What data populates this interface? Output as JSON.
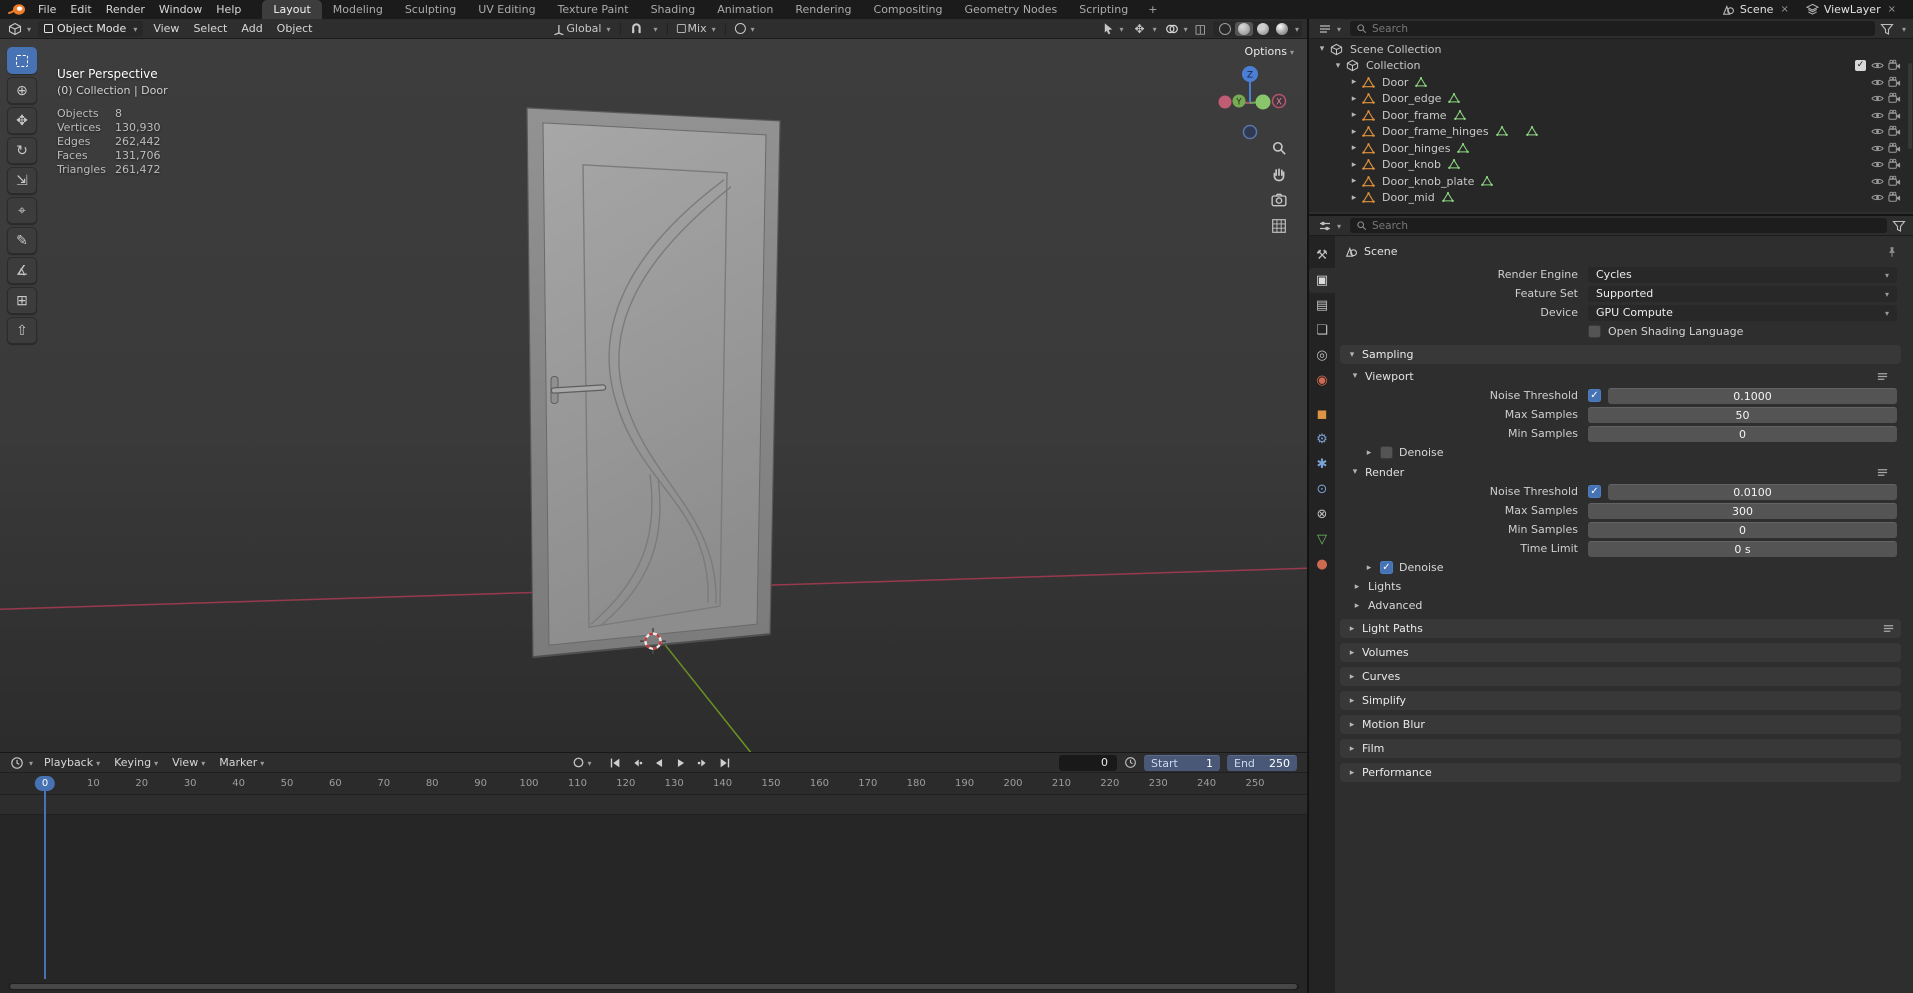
{
  "topbar": {
    "menus": [
      {
        "label": "File"
      },
      {
        "label": "Edit"
      },
      {
        "label": "Render"
      },
      {
        "label": "Window"
      },
      {
        "label": "Help"
      }
    ],
    "workspaces": [
      {
        "label": "Layout",
        "active": true
      },
      {
        "label": "Modeling"
      },
      {
        "label": "Sculpting"
      },
      {
        "label": "UV Editing"
      },
      {
        "label": "Texture Paint"
      },
      {
        "label": "Shading"
      },
      {
        "label": "Animation"
      },
      {
        "label": "Rendering"
      },
      {
        "label": "Compositing"
      },
      {
        "label": "Geometry Nodes"
      },
      {
        "label": "Scripting"
      }
    ],
    "add_workspace_label": "+",
    "scene_label": "Scene",
    "viewlayer_label": "ViewLayer"
  },
  "viewport_header": {
    "mode": "Object Mode",
    "menus": [
      {
        "label": "View"
      },
      {
        "label": "Select"
      },
      {
        "label": "Add"
      },
      {
        "label": "Object"
      }
    ],
    "orientation": "Global",
    "snap_target": "Mix",
    "options_label": "Options"
  },
  "tools": [
    {
      "name": "select-box",
      "glyph": "",
      "active": true
    },
    {
      "name": "cursor",
      "glyph": "⊕"
    },
    {
      "name": "move",
      "glyph": "✥"
    },
    {
      "name": "rotate",
      "glyph": "↻"
    },
    {
      "name": "scale",
      "glyph": "⇲"
    },
    {
      "name": "transform",
      "glyph": "⌖"
    },
    {
      "name": "annotate",
      "glyph": "✎"
    },
    {
      "name": "measure",
      "glyph": "∡"
    },
    {
      "name": "add-cube",
      "glyph": "⊞"
    },
    {
      "name": "extrude",
      "glyph": "⇧"
    }
  ],
  "viewport": {
    "view_label": "User Perspective",
    "context_label": "(0) Collection | Door",
    "stats": [
      {
        "label": "Objects",
        "value": "8"
      },
      {
        "label": "Vertices",
        "value": "130,930"
      },
      {
        "label": "Edges",
        "value": "262,442"
      },
      {
        "label": "Faces",
        "value": "131,706"
      },
      {
        "label": "Triangles",
        "value": "261,472"
      }
    ],
    "gizmo_axes": {
      "x": "X",
      "y": "Y",
      "z": "Z"
    }
  },
  "outliner": {
    "search_placeholder": "Search",
    "root_label": "Scene Collection",
    "collection_label": "Collection",
    "collection_checked": true,
    "objects": [
      {
        "name": "Door"
      },
      {
        "name": "Door_edge"
      },
      {
        "name": "Door_frame"
      },
      {
        "name": "Door_frame_hinges",
        "extra_data": true
      },
      {
        "name": "Door_hinges"
      },
      {
        "name": "Door_knob"
      },
      {
        "name": "Door_knob_plate"
      },
      {
        "name": "Door_mid"
      }
    ]
  },
  "prop_tabs": [
    {
      "name": "tool",
      "glyph": "⚒",
      "color": "#c0c0c0"
    },
    {
      "name": "render",
      "glyph": "▣",
      "color": "#dadada",
      "active": true
    },
    {
      "name": "output",
      "glyph": "▤",
      "color": "#c0c0c0"
    },
    {
      "name": "view-layer",
      "glyph": "❏",
      "color": "#c0c0c0"
    },
    {
      "name": "scene",
      "glyph": "◎",
      "color": "#c0c0c0"
    },
    {
      "name": "world",
      "glyph": "◉",
      "color": "#cd6a50"
    },
    {
      "name": "object",
      "glyph": "◼",
      "color": "#dd9445"
    },
    {
      "name": "modifiers",
      "glyph": "⚙",
      "color": "#7aa3d6"
    },
    {
      "name": "particles",
      "glyph": "✱",
      "color": "#7aa3d6"
    },
    {
      "name": "physics",
      "glyph": "⊙",
      "color": "#7aa3d6"
    },
    {
      "name": "constraints",
      "glyph": "⊗",
      "color": "#c0c0c0"
    },
    {
      "name": "object-data",
      "glyph": "▽",
      "color": "#6fbf63"
    },
    {
      "name": "material",
      "glyph": "●",
      "color": "#cd6a50"
    }
  ],
  "properties": {
    "search_placeholder": "Search",
    "breadcrumb": "Scene",
    "render_engine": {
      "label": "Render Engine",
      "value": "Cycles"
    },
    "feature_set": {
      "label": "Feature Set",
      "value": "Supported"
    },
    "device": {
      "label": "Device",
      "value": "GPU Compute"
    },
    "osl": {
      "label": "Open Shading Language",
      "checked": false
    },
    "sampling": {
      "title": "Sampling",
      "viewport": {
        "title": "Viewport",
        "noise_threshold": {
          "label": "Noise Threshold",
          "value": "0.1000",
          "checked": true
        },
        "max_samples": {
          "label": "Max Samples",
          "value": "50"
        },
        "min_samples": {
          "label": "Min Samples",
          "value": "0"
        },
        "denoise": {
          "label": "Denoise",
          "checked": false
        }
      },
      "render": {
        "title": "Render",
        "noise_threshold": {
          "label": "Noise Threshold",
          "value": "0.0100",
          "checked": true
        },
        "max_samples": {
          "label": "Max Samples",
          "value": "300"
        },
        "min_samples": {
          "label": "Min Samples",
          "value": "0"
        },
        "time_limit": {
          "label": "Time Limit",
          "value": "0 s"
        },
        "denoise": {
          "label": "Denoise",
          "checked": true
        }
      },
      "lights_label": "Lights",
      "advanced_label": "Advanced"
    },
    "collapsed_sections": [
      {
        "label": "Light Paths",
        "preset": true
      },
      {
        "label": "Volumes"
      },
      {
        "label": "Curves"
      },
      {
        "label": "Simplify"
      },
      {
        "label": "Motion Blur"
      },
      {
        "label": "Film"
      },
      {
        "label": "Performance"
      }
    ]
  },
  "timeline": {
    "menus": [
      {
        "label": "Playback",
        "dropdown": true
      },
      {
        "label": "Keying",
        "dropdown": true
      },
      {
        "label": "View"
      },
      {
        "label": "Marker"
      }
    ],
    "current_frame": "0",
    "playhead_frame": "0",
    "start_label": "Start",
    "start_value": "1",
    "end_label": "End",
    "end_value": "250",
    "ticks": [
      "10",
      "20",
      "30",
      "40",
      "50",
      "60",
      "70",
      "80",
      "90",
      "100",
      "110",
      "120",
      "130",
      "140",
      "150",
      "160",
      "170",
      "180",
      "190",
      "200",
      "210",
      "220",
      "230",
      "240",
      "250"
    ]
  }
}
